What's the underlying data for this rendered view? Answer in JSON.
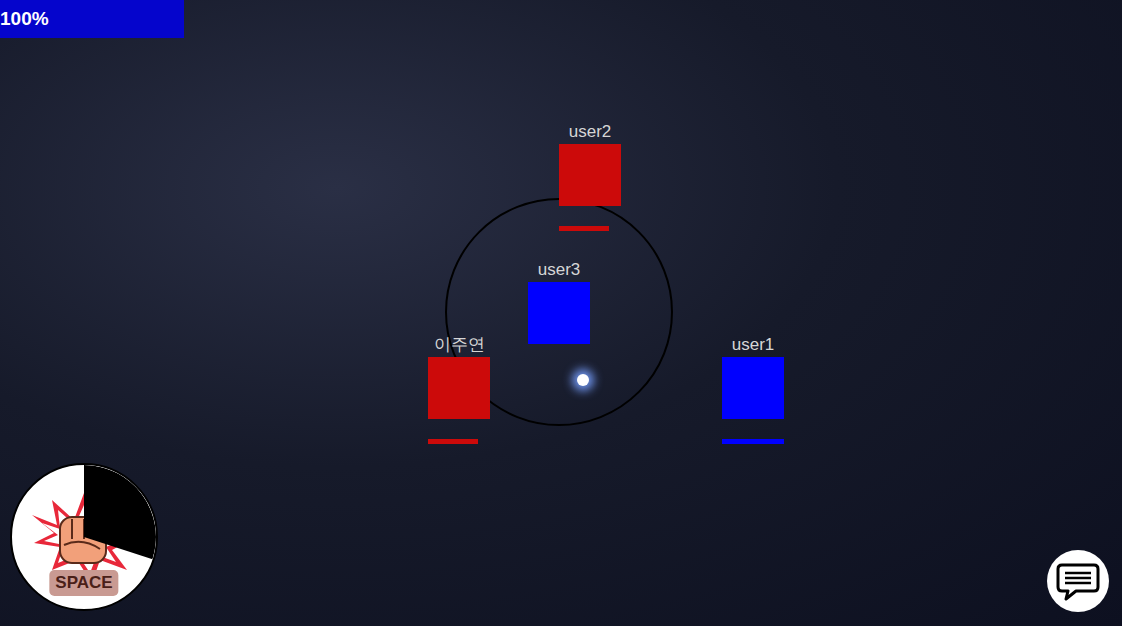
{
  "hud": {
    "hp_text": "100%",
    "hp_level": 1
  },
  "players": [
    {
      "name": "user2",
      "color": "#cc0a0a",
      "hp_level": 0.8,
      "show_hp": true,
      "focused": false
    },
    {
      "name": "user3",
      "color": "#0000ff",
      "hp_level": 1,
      "show_hp": false,
      "focused": true
    },
    {
      "name": "이주연",
      "color": "#cc0a0a",
      "hp_level": 0.8,
      "show_hp": true,
      "focused": false
    },
    {
      "name": "user1",
      "color": "#0000ff",
      "hp_level": 1,
      "show_hp": true,
      "focused": false
    }
  ],
  "skill": {
    "key": "SPACE",
    "cooldown_level": 0.3
  }
}
